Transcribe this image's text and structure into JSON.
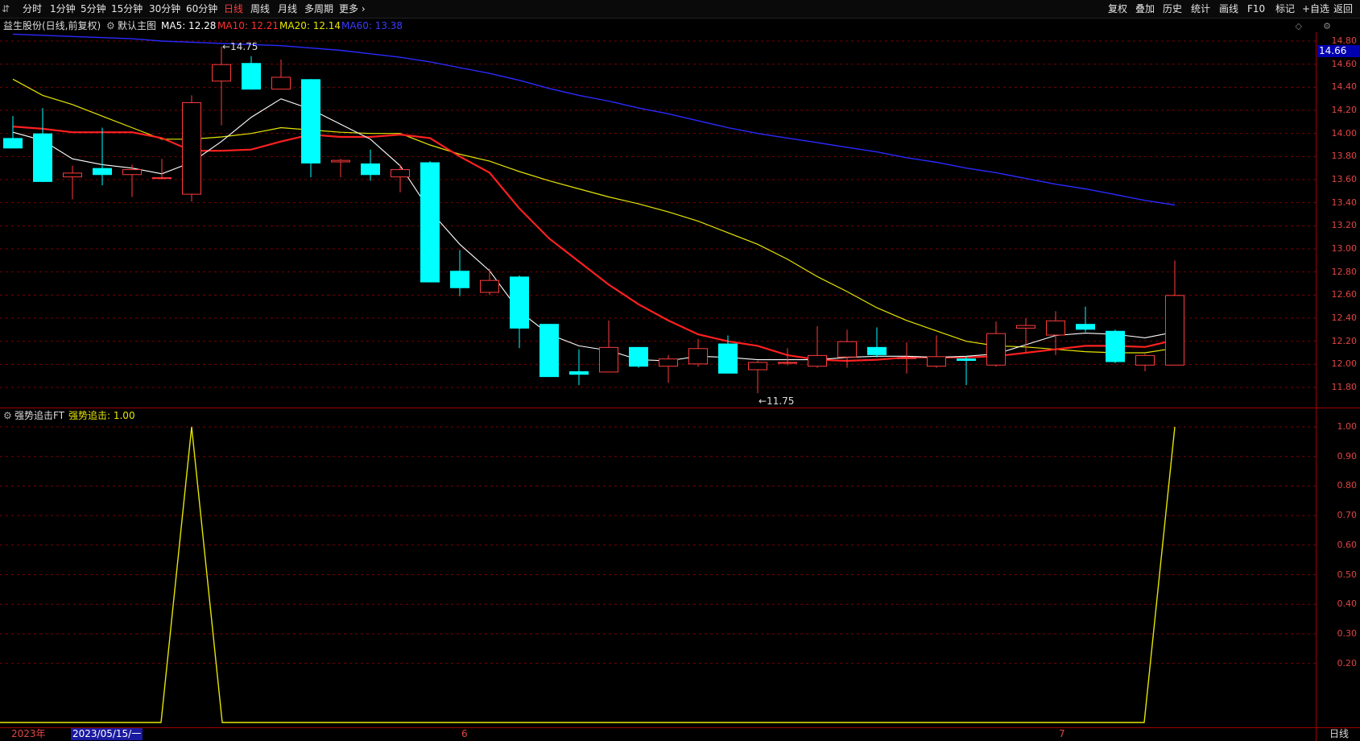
{
  "toolbar": {
    "left_glyph": "⇵",
    "periods": [
      "分时",
      "1分钟",
      "5分钟",
      "15分钟",
      "30分钟",
      "60分钟",
      "日线",
      "周线",
      "月线",
      "多周期",
      "更多 ›"
    ],
    "active_index": 6,
    "right_items": [
      "复权",
      "叠加",
      "历史",
      "统计",
      "画线",
      "F10",
      "标记",
      "+自选",
      "返回"
    ]
  },
  "main_legend": {
    "stock": "益生股份(日线,前复权)",
    "template": "默认主图",
    "ma5": "MA5: 12.28",
    "ma10": "MA10: 12.21",
    "ma20": "MA20: 12.14",
    "ma60": "MA60: 13.38"
  },
  "indicator_legend": {
    "name": "强势追击FT",
    "value": "强势追击: 1.00"
  },
  "price_axis": [
    "14.80",
    "14.60",
    "14.40",
    "14.20",
    "14.00",
    "13.80",
    "13.60",
    "13.40",
    "13.20",
    "13.00",
    "12.80",
    "12.60",
    "12.40",
    "12.20",
    "12.00",
    "11.80"
  ],
  "indicator_axis": [
    "1.00",
    "0.90",
    "0.80",
    "0.70",
    "0.60",
    "0.50",
    "0.40",
    "0.30",
    "0.20"
  ],
  "current_price": "14.66",
  "high_annotation": "14.75",
  "low_annotation": "11.75",
  "dates": {
    "year": "2023年",
    "selected": "2023/05/15/一",
    "month6": "6",
    "month7": "7",
    "period_label": "日线"
  },
  "colors": {
    "up": "#ff3b3b",
    "down": "#00ffff",
    "ma5": "#ffffff",
    "ma10": "#ff2020",
    "ma20": "#e6e600",
    "ma60": "#2a2aff",
    "grid": "#7a0000",
    "indicator": "#e6e600"
  },
  "chart_data": {
    "type": "candlestick",
    "candles": [
      {
        "o": 13.96,
        "c": 13.87,
        "h": 14.15,
        "l": 13.87
      },
      {
        "o": 14.0,
        "c": 13.58,
        "h": 14.22,
        "l": 13.58
      },
      {
        "o": 13.62,
        "c": 13.66,
        "h": 13.72,
        "l": 13.43
      },
      {
        "o": 13.7,
        "c": 13.64,
        "h": 14.05,
        "l": 13.55
      },
      {
        "o": 13.64,
        "c": 13.69,
        "h": 13.73,
        "l": 13.45
      },
      {
        "o": 13.61,
        "c": 13.62,
        "h": 13.78,
        "l": 13.6
      },
      {
        "o": 13.47,
        "c": 14.27,
        "h": 14.33,
        "l": 13.41
      },
      {
        "o": 14.45,
        "c": 14.6,
        "h": 14.75,
        "l": 14.07
      },
      {
        "o": 14.61,
        "c": 14.38,
        "h": 14.67,
        "l": 14.38
      },
      {
        "o": 14.38,
        "c": 14.49,
        "h": 14.64,
        "l": 14.38
      },
      {
        "o": 14.47,
        "c": 13.74,
        "h": 14.47,
        "l": 13.62
      },
      {
        "o": 13.75,
        "c": 13.77,
        "h": 13.78,
        "l": 13.62
      },
      {
        "o": 13.74,
        "c": 13.64,
        "h": 13.86,
        "l": 13.59
      },
      {
        "o": 13.62,
        "c": 13.69,
        "h": 13.73,
        "l": 13.49
      },
      {
        "o": 13.75,
        "c": 12.71,
        "h": 13.76,
        "l": 12.71
      },
      {
        "o": 12.81,
        "c": 12.66,
        "h": 12.99,
        "l": 12.59
      },
      {
        "o": 12.62,
        "c": 12.73,
        "h": 12.83,
        "l": 12.6
      },
      {
        "o": 12.76,
        "c": 12.31,
        "h": 12.77,
        "l": 12.14
      },
      {
        "o": 12.35,
        "c": 11.89,
        "h": 12.35,
        "l": 11.89
      },
      {
        "o": 11.94,
        "c": 11.91,
        "h": 12.13,
        "l": 11.82
      },
      {
        "o": 11.93,
        "c": 12.15,
        "h": 12.38,
        "l": 11.93
      },
      {
        "o": 12.15,
        "c": 11.98,
        "h": 12.15,
        "l": 11.97
      },
      {
        "o": 11.98,
        "c": 12.05,
        "h": 12.08,
        "l": 11.84
      },
      {
        "o": 12.0,
        "c": 12.14,
        "h": 12.22,
        "l": 11.98
      },
      {
        "o": 12.18,
        "c": 11.92,
        "h": 12.25,
        "l": 11.92
      },
      {
        "o": 11.95,
        "c": 12.02,
        "h": 12.03,
        "l": 11.75
      },
      {
        "o": 12.02,
        "c": 12.02,
        "h": 12.14,
        "l": 11.99
      },
      {
        "o": 11.98,
        "c": 12.08,
        "h": 12.33,
        "l": 11.97
      },
      {
        "o": 12.06,
        "c": 12.2,
        "h": 12.3,
        "l": 11.97
      },
      {
        "o": 12.15,
        "c": 12.08,
        "h": 12.32,
        "l": 12.06
      },
      {
        "o": 12.06,
        "c": 12.06,
        "h": 12.19,
        "l": 11.92
      },
      {
        "o": 11.98,
        "c": 12.07,
        "h": 12.25,
        "l": 11.97
      },
      {
        "o": 12.05,
        "c": 12.03,
        "h": 12.07,
        "l": 11.82
      },
      {
        "o": 11.99,
        "c": 12.27,
        "h": 12.37,
        "l": 11.98
      },
      {
        "o": 12.31,
        "c": 12.34,
        "h": 12.4,
        "l": 12.1
      },
      {
        "o": 12.25,
        "c": 12.38,
        "h": 12.46,
        "l": 12.08
      },
      {
        "o": 12.35,
        "c": 12.3,
        "h": 12.5,
        "l": 12.28
      },
      {
        "o": 12.29,
        "c": 12.02,
        "h": 12.3,
        "l": 12.01
      },
      {
        "o": 11.99,
        "c": 12.08,
        "h": 12.09,
        "l": 11.94
      },
      {
        "o": 11.99,
        "c": 12.6,
        "h": 12.9,
        "l": 11.99
      }
    ],
    "ma5": [
      14.01,
      13.94,
      13.78,
      13.73,
      13.7,
      13.65,
      13.75,
      13.93,
      14.14,
      14.3,
      14.21,
      14.08,
      13.95,
      13.72,
      13.33,
      13.04,
      12.81,
      12.46,
      12.26,
      12.16,
      12.12,
      12.04,
      12.03,
      12.07,
      12.06,
      12.04,
      12.04,
      12.04,
      12.06,
      12.07,
      12.07,
      12.06,
      12.07,
      12.09,
      12.17,
      12.25,
      12.27,
      12.26,
      12.23,
      12.28
    ],
    "ma10": [
      14.06,
      14.04,
      14.01,
      14.01,
      14.01,
      13.96,
      13.85,
      13.85,
      13.86,
      13.93,
      13.99,
      13.97,
      13.97,
      13.99,
      13.96,
      13.8,
      13.66,
      13.35,
      13.09,
      12.89,
      12.69,
      12.52,
      12.38,
      12.26,
      12.2,
      12.16,
      12.08,
      12.04,
      12.03,
      12.04,
      12.06,
      12.06,
      12.06,
      12.07,
      12.1,
      12.13,
      12.16,
      12.16,
      12.15,
      12.21
    ],
    "ma20": [
      14.47,
      14.33,
      14.25,
      14.15,
      14.05,
      13.95,
      13.95,
      13.97,
      14.0,
      14.05,
      14.03,
      14.01,
      14.0,
      14.0,
      13.9,
      13.82,
      13.76,
      13.67,
      13.59,
      13.52,
      13.45,
      13.39,
      13.32,
      13.24,
      13.14,
      13.04,
      12.91,
      12.76,
      12.63,
      12.49,
      12.38,
      12.29,
      12.2,
      12.16,
      12.15,
      12.13,
      12.11,
      12.1,
      12.1,
      12.14
    ],
    "ma60": [
      14.86,
      14.85,
      14.84,
      14.83,
      14.82,
      14.8,
      14.79,
      14.78,
      14.77,
      14.76,
      14.74,
      14.72,
      14.69,
      14.66,
      14.62,
      14.57,
      14.52,
      14.46,
      14.39,
      14.33,
      14.28,
      14.22,
      14.17,
      14.11,
      14.05,
      14.0,
      13.96,
      13.92,
      13.88,
      13.84,
      13.79,
      13.75,
      13.7,
      13.66,
      13.61,
      13.56,
      13.52,
      13.47,
      13.42,
      13.38
    ],
    "indicator": [
      0,
      0,
      0,
      0,
      0,
      0,
      1,
      0,
      0,
      0,
      0,
      0,
      0,
      0,
      0,
      0,
      0,
      0,
      0,
      0,
      0,
      0,
      0,
      0,
      0,
      0,
      0,
      0,
      0,
      0,
      0,
      0,
      0,
      0,
      0,
      0,
      0,
      0,
      0,
      1
    ],
    "price_range": [
      11.7,
      14.9
    ],
    "indicator_range": [
      0,
      1.0
    ]
  }
}
